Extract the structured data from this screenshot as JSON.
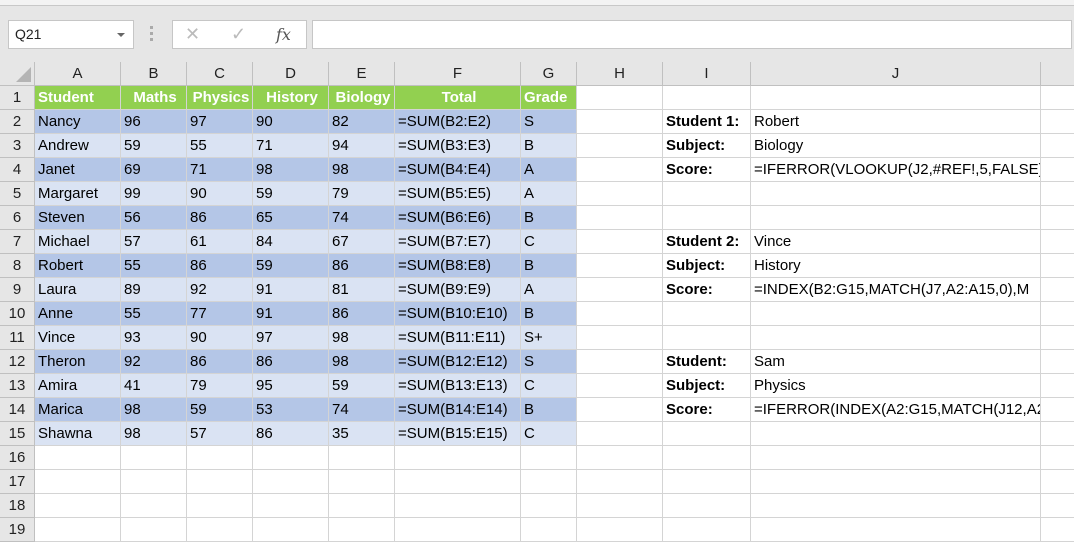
{
  "name_box": {
    "value": "Q21"
  },
  "formula_bar": {
    "cancel": "✕",
    "enter": "✓",
    "fx": "fx",
    "value": ""
  },
  "columns": [
    "A",
    "B",
    "C",
    "D",
    "E",
    "F",
    "G",
    "H",
    "I",
    "J",
    ""
  ],
  "rows": [
    "1",
    "2",
    "3",
    "4",
    "5",
    "6",
    "7",
    "8",
    "9",
    "10",
    "11",
    "12",
    "13",
    "14",
    "15",
    "16",
    "17",
    "18",
    "19"
  ],
  "table": {
    "headers": [
      "Student",
      "Maths",
      "Physics",
      "History",
      "Biology",
      "Total",
      "Grade"
    ],
    "records": [
      [
        "Nancy",
        "96",
        "97",
        "90",
        "82",
        "=SUM(B2:E2)",
        "S"
      ],
      [
        "Andrew",
        "59",
        "55",
        "71",
        "94",
        "=SUM(B3:E3)",
        "B"
      ],
      [
        "Janet",
        "69",
        "71",
        "98",
        "98",
        "=SUM(B4:E4)",
        "A"
      ],
      [
        "Margaret",
        "99",
        "90",
        "59",
        "79",
        "=SUM(B5:E5)",
        "A"
      ],
      [
        "Steven",
        "56",
        "86",
        "65",
        "74",
        "=SUM(B6:E6)",
        "B"
      ],
      [
        "Michael",
        "57",
        "61",
        "84",
        "67",
        "=SUM(B7:E7)",
        "C"
      ],
      [
        "Robert",
        "55",
        "86",
        "59",
        "86",
        "=SUM(B8:E8)",
        "B"
      ],
      [
        "Laura",
        "89",
        "92",
        "91",
        "81",
        "=SUM(B9:E9)",
        "A"
      ],
      [
        "Anne",
        "55",
        "77",
        "91",
        "86",
        "=SUM(B10:E10)",
        "B"
      ],
      [
        "Vince",
        "93",
        "90",
        "97",
        "98",
        "=SUM(B11:E11)",
        "S+"
      ],
      [
        "Theron",
        "92",
        "86",
        "86",
        "98",
        "=SUM(B12:E12)",
        "S"
      ],
      [
        "Amira",
        "41",
        "79",
        "95",
        "59",
        "=SUM(B13:E13)",
        "C"
      ],
      [
        "Marica",
        "98",
        "59",
        "53",
        "74",
        "=SUM(B14:E14)",
        "B"
      ],
      [
        "Shawna",
        "98",
        "57",
        "86",
        "35",
        "=SUM(B15:E15)",
        "C"
      ]
    ]
  },
  "lookups": [
    {
      "row": 2,
      "label": "Student 1:",
      "value": "Robert"
    },
    {
      "row": 3,
      "label": "Subject:",
      "value": "Biology"
    },
    {
      "row": 4,
      "label": "Score:",
      "value": "=IFERROR(VLOOKUP(J2,#REF!,5,FALSE),"
    },
    {
      "row": 7,
      "label": "Student 2:",
      "value": "Vince"
    },
    {
      "row": 8,
      "label": "Subject:",
      "value": "History"
    },
    {
      "row": 9,
      "label": "Score:",
      "value": "=INDEX(B2:G15,MATCH(J7,A2:A15,0),M"
    },
    {
      "row": 12,
      "label": "Student:",
      "value": "Sam"
    },
    {
      "row": 13,
      "label": "Subject:",
      "value": "Physics"
    },
    {
      "row": 14,
      "label": "Score:",
      "value": "=IFERROR(INDEX(A2:G15,MATCH(J12,A2"
    }
  ]
}
